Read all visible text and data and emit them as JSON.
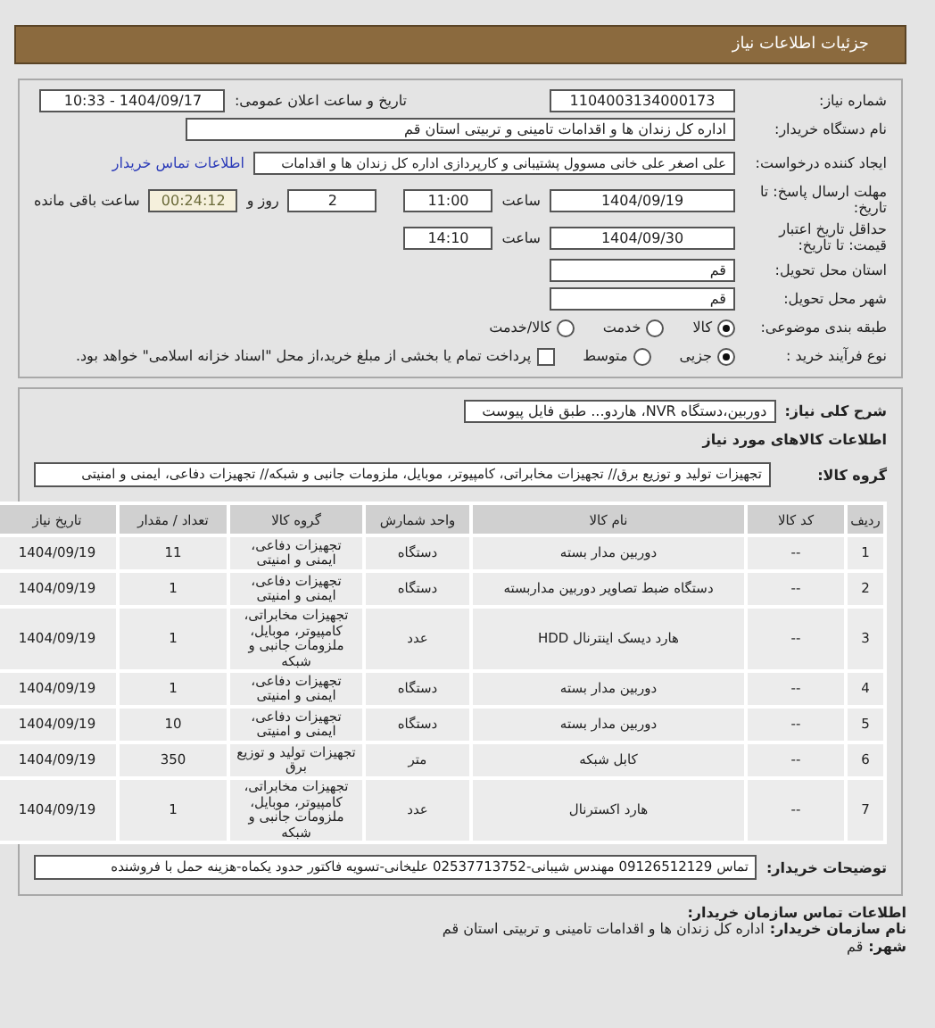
{
  "header": {
    "title": "جزئیات اطلاعات نیاز"
  },
  "need_number": {
    "label": "شماره نیاز:",
    "value": "1104003134000173"
  },
  "announce": {
    "label": "تاریخ و ساعت اعلان عمومی:",
    "value": "1404/09/17 - 10:33"
  },
  "buyer_name": {
    "label": "نام دستگاه خریدار:",
    "value": "اداره کل زندان ها و اقدامات تامینی و تربیتی استان قم"
  },
  "creator": {
    "label": "ایجاد کننده درخواست:",
    "value": "علی اصغر علی خانی مسوول پشتیبانی و کارپردازی اداره کل زندان ها و اقدامات",
    "link": "اطلاعات تماس خریدار"
  },
  "deadline": {
    "label": "مهلت ارسال پاسخ: تا تاریخ:",
    "date": "1404/09/19",
    "time_label": "ساعت",
    "time": "11:00",
    "days": "2",
    "days_label": "روز و",
    "remaining": "00:24:12",
    "remaining_label": "ساعت باقی مانده"
  },
  "validity": {
    "label": "حداقل تاریخ اعتبار قیمت: تا تاریخ:",
    "date": "1404/09/30",
    "time_label": "ساعت",
    "time": "14:10"
  },
  "province": {
    "label": "استان محل تحویل:",
    "value": "قم"
  },
  "city": {
    "label": "شهر محل تحویل:",
    "value": "قم"
  },
  "category": {
    "label": "طبقه بندی موضوعی:",
    "options": [
      {
        "label": "کالا",
        "selected": true
      },
      {
        "label": "خدمت",
        "selected": false
      },
      {
        "label": "کالا/خدمت",
        "selected": false
      }
    ]
  },
  "process": {
    "label": "نوع فرآیند خرید :",
    "options": [
      {
        "label": "جزیی",
        "selected": true
      },
      {
        "label": "متوسط",
        "selected": false
      }
    ],
    "payment": {
      "checked": false,
      "label": "پرداخت تمام یا بخشی از مبلغ خرید،از محل \"اسناد خزانه اسلامی\" خواهد بود."
    }
  },
  "description": {
    "label": "شرح کلی نیاز:",
    "value": "دوربین،دستگاه NVR، هاردو... طبق فایل پیوست"
  },
  "goods_title": "اطلاعات کالاهای مورد نیاز",
  "goods_group": {
    "label": "گروه کالا:",
    "value": "تجهیزات تولید و توزیع برق// تجهیزات مخابراتی، کامپیوتر، موبایل، ملزومات جانبی و شبکه// تجهیزات دفاعی، ایمنی و امنیتی"
  },
  "table": {
    "columns": [
      "ردیف",
      "کد کالا",
      "نام کالا",
      "واحد شمارش",
      "گروه کالا",
      "تعداد / مقدار",
      "تاریخ نیاز"
    ],
    "rows": [
      [
        "1",
        "--",
        "دوربین مدار بسته",
        "دستگاه",
        "تجهیزات دفاعی، ایمنی و امنیتی",
        "11",
        "1404/09/19"
      ],
      [
        "2",
        "--",
        "دستگاه ضبط تصاویر دوربین مداربسته",
        "دستگاه",
        "تجهیزات دفاعی، ایمنی و امنیتی",
        "1",
        "1404/09/19"
      ],
      [
        "3",
        "--",
        "هارد دیسک اینترنال HDD",
        "عدد",
        "تجهیزات مخابراتی، کامپیوتر، موبایل، ملزومات جانبی و شبکه",
        "1",
        "1404/09/19"
      ],
      [
        "4",
        "--",
        "دوربین مدار بسته",
        "دستگاه",
        "تجهیزات دفاعی، ایمنی و امنیتی",
        "1",
        "1404/09/19"
      ],
      [
        "5",
        "--",
        "دوربین مدار بسته",
        "دستگاه",
        "تجهیزات دفاعی، ایمنی و امنیتی",
        "10",
        "1404/09/19"
      ],
      [
        "6",
        "--",
        "کابل شبکه",
        "متر",
        "تجهیزات تولید و توزیع برق",
        "350",
        "1404/09/19"
      ],
      [
        "7",
        "--",
        "هارد اکسترنال",
        "عدد",
        "تجهیزات مخابراتی، کامپیوتر، موبایل، ملزومات جانبی و شبکه",
        "1",
        "1404/09/19"
      ]
    ]
  },
  "notes": {
    "label": "توضیحات خریدار:",
    "value": "تماس 09126512129 مهندس شیبانی-02537713752 علیخانی-تسویه فاکتور حدود یکماه-هزینه حمل با فروشنده"
  },
  "contact": {
    "title": "اطلاعات تماس سازمان خریدار:",
    "lines": [
      {
        "label": "نام سازمان خریدار:",
        "value": "اداره کل زندان ها و اقدامات تامینی و تربیتی استان قم"
      },
      {
        "label": "شهر:",
        "value": "قم"
      }
    ]
  }
}
